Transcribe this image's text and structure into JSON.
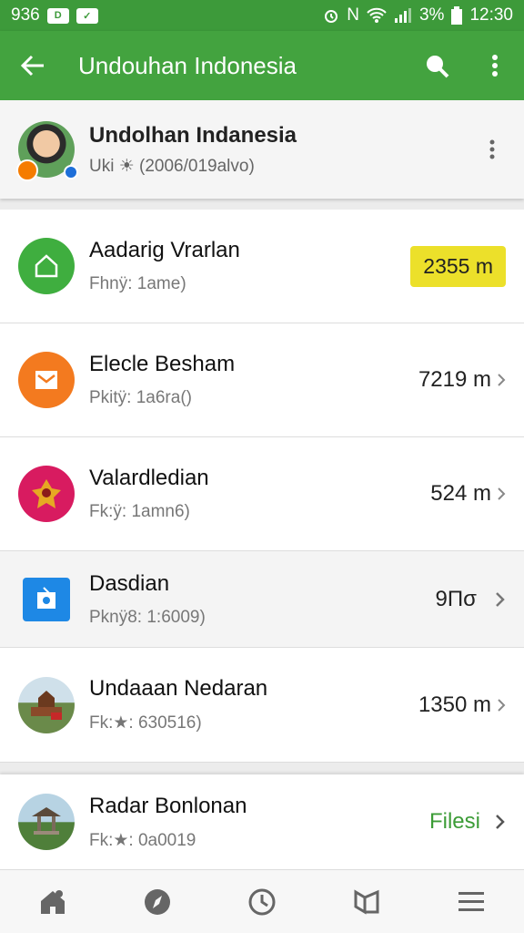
{
  "status_bar": {
    "left_text": "936",
    "chip_label": "D",
    "battery_text": "3%",
    "time": "12:30"
  },
  "app_bar": {
    "title": "Undouhan Indonesia"
  },
  "profile": {
    "name": "Undolhan Indanesia",
    "subtitle": "Uki ☀ (2006/019alvo)"
  },
  "rows": [
    {
      "title": "Aadarig Vrarlan",
      "subtitle": "Fhnÿ: 1ame)",
      "value": "2355 m",
      "icon": "home-icon",
      "color": "#3fae3f"
    },
    {
      "title": "Elecle Besham",
      "subtitle": "Pkitÿ: 1a6ra()",
      "value": "7219 m",
      "icon": "mail-icon",
      "color": "#f37a1f"
    },
    {
      "title": "Valardledian",
      "subtitle": "Fk:ÿ: 1amn6)",
      "value": "524 m",
      "icon": "garuda-emblem-icon",
      "color": "#d81b60"
    },
    {
      "title": "Dasdian",
      "subtitle": "Pknÿ8: 1:6009)",
      "value": "9Πσ",
      "icon": "app-square-icon",
      "color": "#1e88e5"
    },
    {
      "title": "Undaaan Nedaran",
      "subtitle": "Fk:★: 630516)",
      "value": "1350 m",
      "icon": "landmark-photo-icon",
      "color": "#8a6b4a"
    }
  ],
  "card": {
    "title": "Radar Bonlonan",
    "subtitle": "Fk:★: 0a0019",
    "value": "Filesi",
    "icon": "pavilion-photo-icon"
  },
  "nav": [
    {
      "icon": "home-nav-icon"
    },
    {
      "icon": "compass-nav-icon"
    },
    {
      "icon": "clock-nav-icon"
    },
    {
      "icon": "map-nav-icon"
    },
    {
      "icon": "menu-nav-icon"
    }
  ],
  "colors": {
    "app_bar": "#43a33f",
    "status_bar": "#3d9a3a",
    "pill": "#ece02a",
    "accent_green": "#3c9c37"
  }
}
